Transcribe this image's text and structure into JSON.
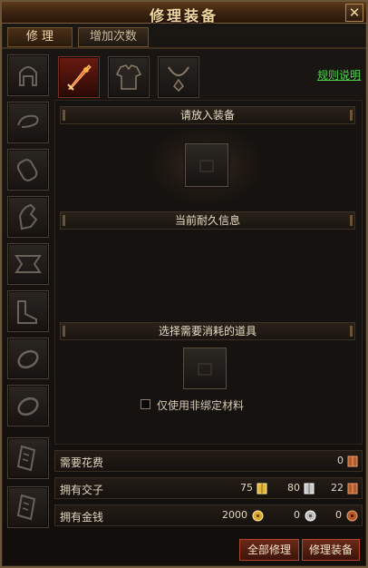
{
  "window": {
    "title": "修理装备",
    "close_label": "✕"
  },
  "tabs": [
    {
      "label": "修 理",
      "active": true
    },
    {
      "label": "增加次数",
      "active": false
    }
  ],
  "equip_slots_top": [
    {
      "icon": "sword-icon",
      "selected": true
    },
    {
      "icon": "armor-icon",
      "selected": false
    },
    {
      "icon": "necklace-icon",
      "selected": false
    }
  ],
  "side_slots": [
    {
      "icon": "helmet-icon"
    },
    {
      "icon": "bracelet-icon"
    },
    {
      "icon": "bracer-icon"
    },
    {
      "icon": "glove-icon"
    },
    {
      "icon": "belt-icon"
    },
    {
      "icon": "boots-icon"
    },
    {
      "icon": "ring-icon"
    },
    {
      "icon": "ring-icon"
    },
    {
      "icon": "talisman-icon"
    },
    {
      "icon": "talisman-icon"
    }
  ],
  "rule_link": "规则说明",
  "sections": {
    "put_equipment": "请放入装备",
    "durability_info": "当前耐久信息",
    "consume_items": "选择需要消耗的道具"
  },
  "checkbox": {
    "label": "仅使用非绑定材料",
    "checked": false
  },
  "cost": {
    "label": "需要花费",
    "value": "0"
  },
  "owned_jiaozi": {
    "label": "拥有交子",
    "gold": "75",
    "silver": "80",
    "copper": "22"
  },
  "owned_money": {
    "label": "拥有金钱",
    "gold": "2000",
    "silver": "0",
    "copper": "0"
  },
  "buttons": {
    "repair_all": "全部修理",
    "repair_equip": "修理装备"
  },
  "colors": {
    "link": "#4fd34a",
    "button_border": "#b5452a",
    "gold": "#e3b53a"
  }
}
